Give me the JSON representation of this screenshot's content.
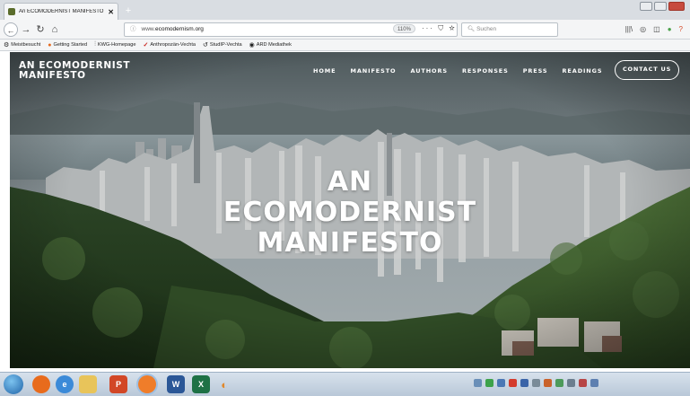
{
  "browser": {
    "tab_title": "An ECOMODERNIST MANIFESTO",
    "new_tab": "+",
    "url_prefix": "www.",
    "url_domain": "ecomodernism.org",
    "zoom": "110%",
    "page_actions": "··· ⛉ ☆",
    "search_placeholder": "Suchen",
    "bookmarks": [
      {
        "icon": "gear-icon",
        "label": "Meistbesucht"
      },
      {
        "icon": "firefox-icon",
        "label": "Getting Started"
      },
      {
        "icon": "link-icon",
        "label": "KWG-Homepage"
      },
      {
        "icon": "checkmark-icon",
        "label": "Anthropozän-Vechta"
      },
      {
        "icon": "link-icon",
        "label": "StudIP-Vechta"
      },
      {
        "icon": "globe-icon",
        "label": "ARD Mediathek"
      }
    ]
  },
  "site": {
    "logo_line1": "AN ECOMODERNIST",
    "logo_line2": "MANIFESTO",
    "nav": [
      {
        "label": "HOME"
      },
      {
        "label": "MANIFESTO"
      },
      {
        "label": "AUTHORS"
      },
      {
        "label": "RESPONSES"
      },
      {
        "label": "PRESS"
      },
      {
        "label": "READINGS"
      }
    ],
    "contact": "CONTACT US",
    "hero_line1": "AN",
    "hero_line2": "ECOMODERNIST",
    "hero_line3": "MANIFESTO"
  },
  "taskbar": {
    "apps": [
      {
        "icon": "start-icon"
      },
      {
        "icon": "firefox-icon"
      },
      {
        "icon": "internet-explorer-icon"
      },
      {
        "icon": "file-explorer-icon"
      },
      {
        "icon": "powerpoint-icon"
      },
      {
        "icon": "firefox-active-icon"
      },
      {
        "icon": "word-icon"
      },
      {
        "icon": "excel-icon"
      },
      {
        "icon": "media-icon"
      }
    ]
  },
  "colors": {
    "forest_dark": "#1f3418",
    "forest_mid": "#3c5a2a",
    "sky": "#9ea7ab",
    "water": "#7c8a8f",
    "city": "#b9bcbd"
  }
}
